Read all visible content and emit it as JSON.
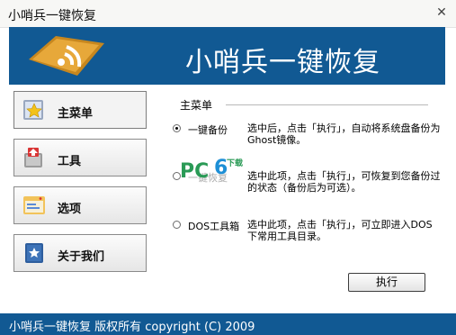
{
  "window": {
    "title": "小哨兵一键恢复",
    "close_glyph": "✕"
  },
  "banner": {
    "title": "小哨兵一键恢复",
    "logo_icon": "rss-feed-icon"
  },
  "nav": [
    {
      "label": "主菜单",
      "icon": "star-icon",
      "active": true
    },
    {
      "label": "工具",
      "icon": "toolbox-upload-icon",
      "active": false
    },
    {
      "label": "选项",
      "icon": "window-settings-icon",
      "active": false
    },
    {
      "label": "关于我们",
      "icon": "book-star-icon",
      "active": false
    }
  ],
  "panel": {
    "title": "主菜单",
    "options": [
      {
        "label": "一键备份",
        "desc": "选中后，点击「执行」，自动将系统盘备份为Ghost镜像。",
        "checked": true
      },
      {
        "label": "一键恢复",
        "desc": "选中此项，点击「执行」，可恢复到您备份过的状态（备份后为可选）。",
        "checked": false
      },
      {
        "label": "DOS工具箱",
        "desc": "选中此项，点击「执行」，可立即进入DOS下常用工具目录。",
        "checked": false
      }
    ],
    "execute_label": "执行"
  },
  "watermark": {
    "pc": "PC",
    "six": "6",
    "xz": "下载"
  },
  "footer": {
    "text": "小哨兵一键恢复  版权所有  copyright (C) 2009"
  },
  "colors": {
    "brand": "#115993",
    "nav_border": "#8a8a8a"
  }
}
